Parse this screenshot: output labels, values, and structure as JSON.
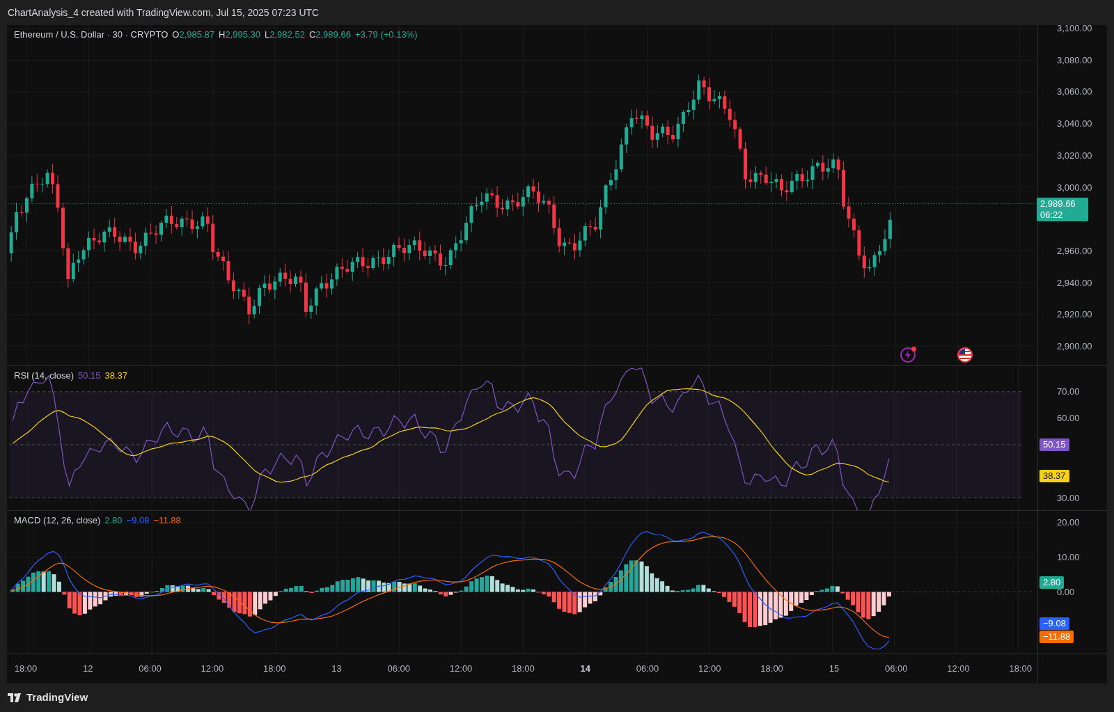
{
  "header": {
    "title": "ChartAnalysis_4 created with TradingView.com, Jul 15, 2025 07:23 UTC"
  },
  "price_pane": {
    "symbol": "Ethereum / U.S. Dollar · 30 · CRYPTO",
    "ohlc": [
      {
        "label": "O",
        "value": "2,985.87",
        "color": "#22ab94"
      },
      {
        "label": "H",
        "value": "2,995.30",
        "color": "#22ab94"
      },
      {
        "label": "L",
        "value": "2,982.52",
        "color": "#22ab94"
      },
      {
        "label": "C",
        "value": "2,989.66",
        "color": "#22ab94"
      }
    ],
    "change": {
      "text": "+3.79 (+0.13%)",
      "color": "#22ab94"
    },
    "y_ticks": [
      "3,100.00",
      "3,080.00",
      "3,060.00",
      "3,040.00",
      "3,020.00",
      "3,000.00",
      "2,960.00",
      "2,940.00",
      "2,920.00",
      "2,900.00"
    ],
    "last_price": {
      "price": "2,989.66",
      "countdown": "06:22",
      "color": "#22ab94"
    }
  },
  "rsi_pane": {
    "title": "RSI (14, close)",
    "values": [
      {
        "text": "50.15",
        "color": "#7e57c2"
      },
      {
        "text": "38.37",
        "color": "#f7d117"
      }
    ],
    "y_ticks": [
      "70.00",
      "60.00",
      "30.00"
    ],
    "badges": [
      {
        "text": "50.15",
        "color": "#7e57c2"
      },
      {
        "text": "38.37",
        "color": "#f7d117"
      }
    ]
  },
  "macd_pane": {
    "title": "MACD (12, 26, close)",
    "values": [
      {
        "text": "2.80",
        "color": "#22ab94"
      },
      {
        "text": "−9.08",
        "color": "#2962ff"
      },
      {
        "text": "−11.88",
        "color": "#ff6d00"
      }
    ],
    "y_ticks": [
      "20.00",
      "10.00",
      "0.00"
    ],
    "badges": [
      {
        "text": "2.80",
        "color": "#22ab94"
      },
      {
        "text": "−9.08",
        "color": "#2962ff"
      },
      {
        "text": "−11.88",
        "color": "#ff6d00"
      }
    ]
  },
  "time_axis": [
    {
      "label": "18:00",
      "bold": false
    },
    {
      "label": "12",
      "bold": false
    },
    {
      "label": "06:00",
      "bold": false
    },
    {
      "label": "12:00",
      "bold": false
    },
    {
      "label": "18:00",
      "bold": false
    },
    {
      "label": "13",
      "bold": false
    },
    {
      "label": "06:00",
      "bold": false
    },
    {
      "label": "12:00",
      "bold": false
    },
    {
      "label": "18:00",
      "bold": false
    },
    {
      "label": "14",
      "bold": true
    },
    {
      "label": "06:00",
      "bold": false
    },
    {
      "label": "12:00",
      "bold": false
    },
    {
      "label": "18:00",
      "bold": false
    },
    {
      "label": "15",
      "bold": false
    },
    {
      "label": "06:00",
      "bold": false
    },
    {
      "label": "12:00",
      "bold": false
    },
    {
      "label": "18:00",
      "bold": false
    }
  ],
  "footer": {
    "brand": "TradingView"
  }
}
